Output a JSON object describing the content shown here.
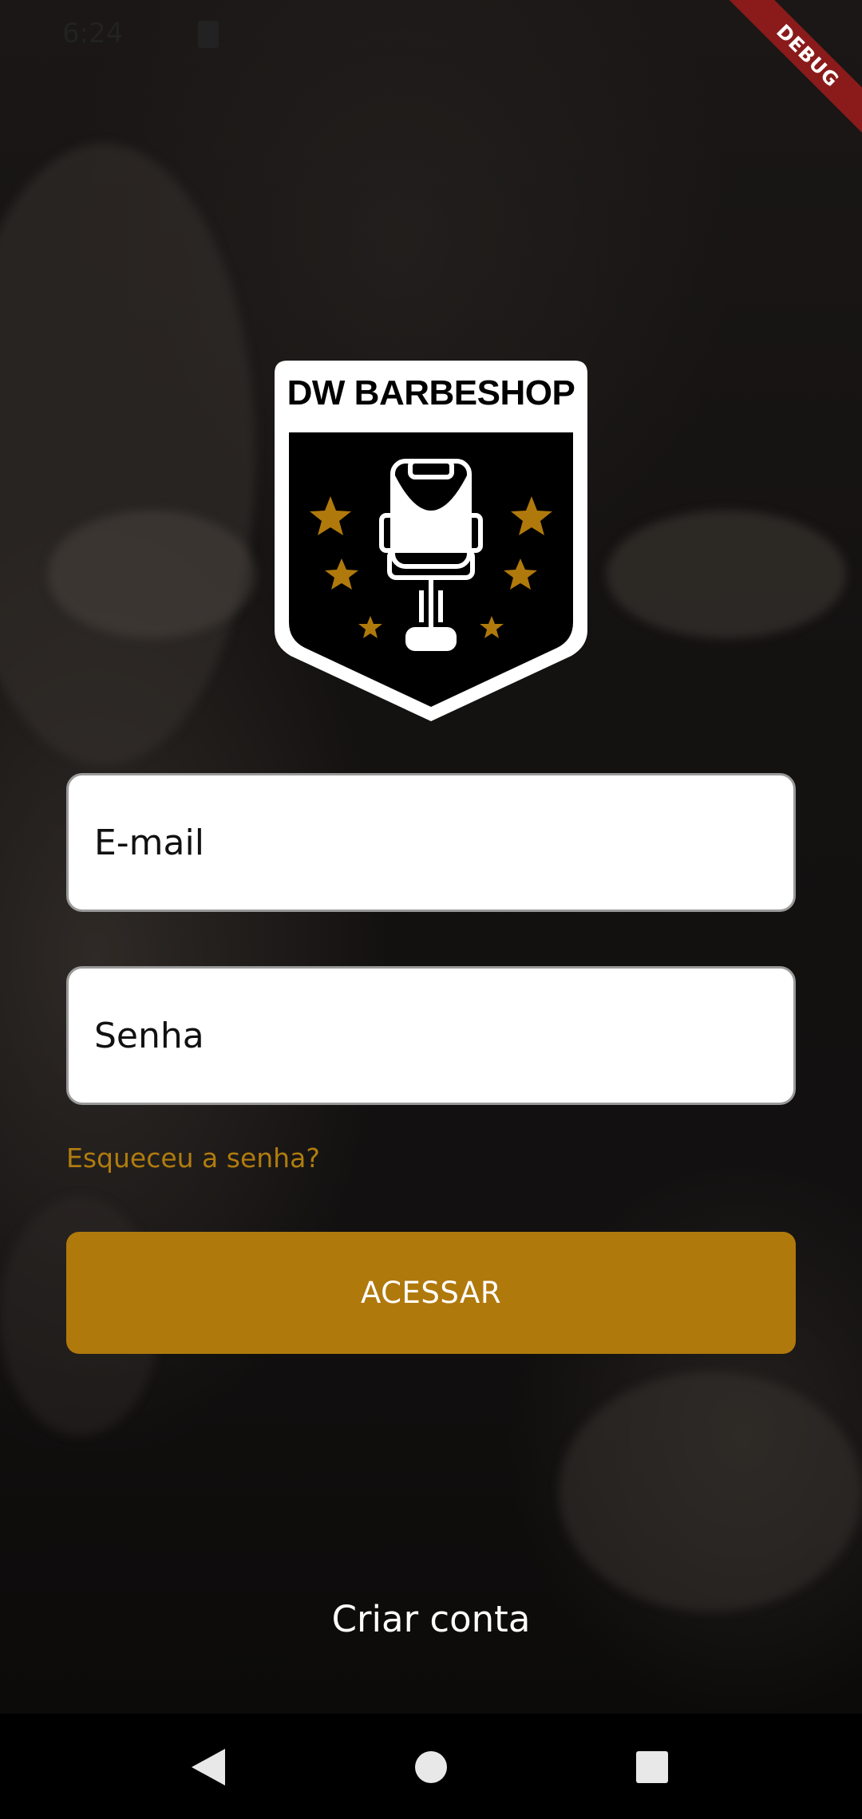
{
  "status_bar": {
    "time": "6:24"
  },
  "debug_banner": {
    "label": "DEBUG"
  },
  "logo": {
    "title": "DW BARBESHOP"
  },
  "form": {
    "email_placeholder": "E-mail",
    "password_placeholder": "Senha",
    "forgot_password": "Esqueceu a senha?",
    "submit_label": "ACESSAR"
  },
  "footer": {
    "create_account": "Criar conta"
  },
  "colors": {
    "accent": "#b0790c",
    "forgot_link": "#b07c0e"
  },
  "nav_bar": {
    "back_icon": "back-triangle",
    "home_icon": "home-circle",
    "recents_icon": "recents-square"
  }
}
